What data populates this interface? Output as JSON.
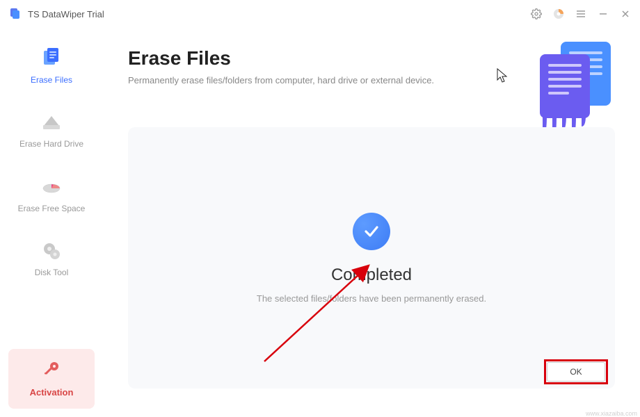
{
  "titlebar": {
    "app_name": "TS DataWiper Trial"
  },
  "sidebar": {
    "items": [
      {
        "label": "Erase Files"
      },
      {
        "label": "Erase Hard Drive"
      },
      {
        "label": "Erase Free Space"
      },
      {
        "label": "Disk Tool"
      }
    ],
    "activation_label": "Activation"
  },
  "main": {
    "title": "Erase Files",
    "subtitle": "Permanently erase files/folders from computer, hard drive or external device.",
    "status_title": "Completed",
    "status_message": "The selected files/folders have been permanently erased.",
    "ok_label": "OK"
  },
  "watermark": "www.xiazaiba.com"
}
